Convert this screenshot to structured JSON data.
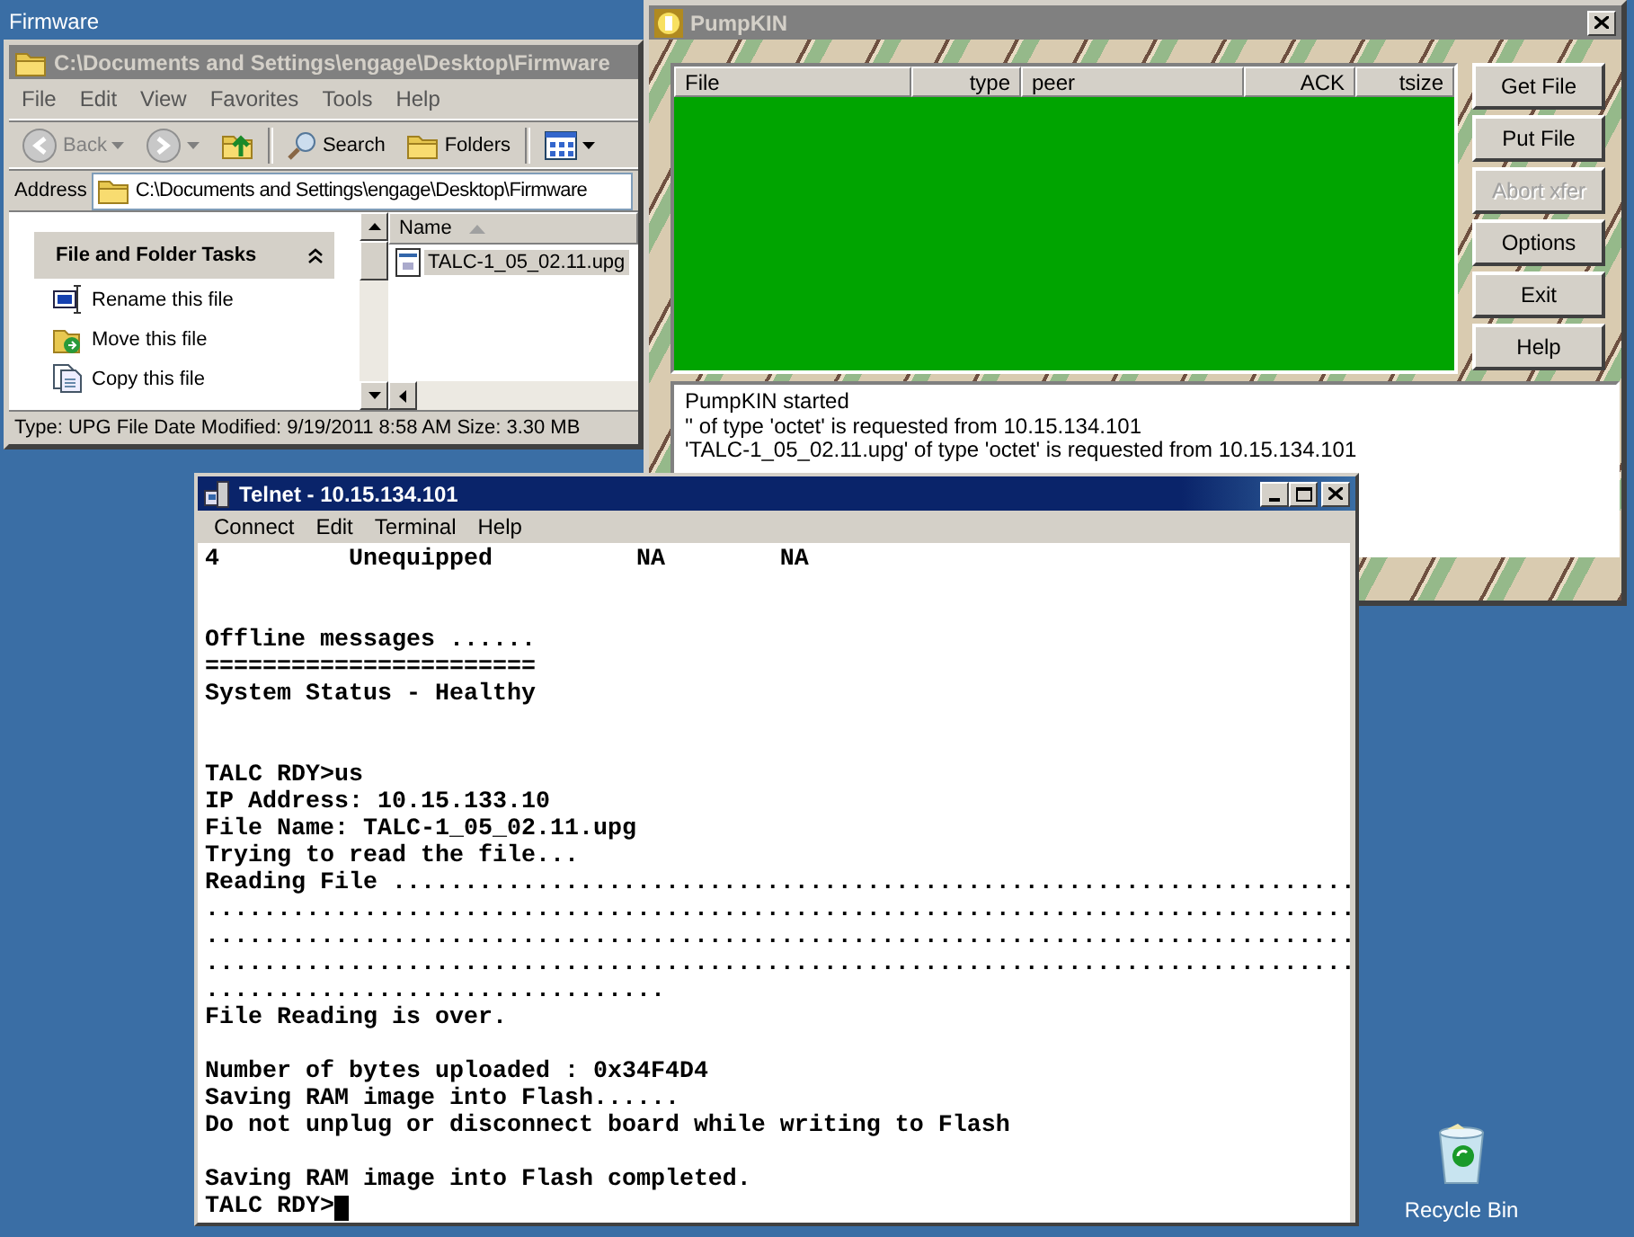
{
  "desktop": {
    "icons": [
      {
        "label": "Firmware",
        "kind": "folder"
      },
      {
        "label": "Recycle Bin",
        "kind": "recycle"
      }
    ]
  },
  "explorer": {
    "title": "C:\\Documents and Settings\\engage\\Desktop\\Firmware",
    "active": false,
    "menu": [
      "File",
      "Edit",
      "View",
      "Favorites",
      "Tools",
      "Help"
    ],
    "toolbar": {
      "back": "Back",
      "search": "Search",
      "folders": "Folders"
    },
    "address_label": "Address",
    "address": "C:\\Documents and Settings\\engage\\Desktop\\Firmware",
    "tasks_title": "File and Folder Tasks",
    "tasks": [
      "Rename this file",
      "Move this file",
      "Copy this file"
    ],
    "column": "Name",
    "files": [
      {
        "name": "TALC-1_05_02.11.upg",
        "selected": true
      }
    ],
    "status": "Type: UPG File Date Modified: 9/19/2011 8:58 AM Size: 3.30 MB"
  },
  "pumpkin": {
    "title": "PumpKIN",
    "active": false,
    "columns": [
      "File",
      "type",
      "peer",
      "ACK",
      "tsize"
    ],
    "buttons": [
      {
        "label": "Get File",
        "disabled": false
      },
      {
        "label": "Put File",
        "disabled": false
      },
      {
        "label": "Abort xfer",
        "disabled": true
      },
      {
        "label": "Options",
        "disabled": false
      },
      {
        "label": "Exit",
        "disabled": false
      },
      {
        "label": "Help",
        "disabled": false
      }
    ],
    "log": [
      "PumpKIN started",
      "'' of type 'octet' is requested from 10.15.134.101",
      "'TALC-1_05_02.11.upg' of type 'octet' is requested from 10.15.134.101"
    ]
  },
  "telnet": {
    "title": "Telnet - 10.15.134.101",
    "active": true,
    "menu": [
      "Connect",
      "Edit",
      "Terminal",
      "Help"
    ],
    "lines": [
      {
        "kind": "text",
        "text": "4         Unequipped          NA        NA"
      },
      {
        "kind": "blank"
      },
      {
        "kind": "blank"
      },
      {
        "kind": "text",
        "text": "Offline messages ......"
      },
      {
        "kind": "text",
        "text": "======================="
      },
      {
        "kind": "text",
        "text": "System Status - Healthy"
      },
      {
        "kind": "blank"
      },
      {
        "kind": "blank"
      },
      {
        "kind": "text",
        "text": "TALC RDY>us"
      },
      {
        "kind": "text",
        "text": "IP Address: 10.15.133.10"
      },
      {
        "kind": "text",
        "text": "File Name: TALC-1_05_02.11.upg"
      },
      {
        "kind": "text",
        "text": "Trying to read the file..."
      },
      {
        "kind": "text",
        "text": "Reading File ..................................................................."
      },
      {
        "kind": "text",
        "text": "................................................................................"
      },
      {
        "kind": "text",
        "text": "................................................................................"
      },
      {
        "kind": "text",
        "text": "................................................................................"
      },
      {
        "kind": "text",
        "text": "................................"
      },
      {
        "kind": "text",
        "text": "File Reading is over."
      },
      {
        "kind": "blank"
      },
      {
        "kind": "text",
        "text": "Number of bytes uploaded : 0x34F4D4"
      },
      {
        "kind": "text",
        "text": "Saving RAM image into Flash......"
      },
      {
        "kind": "text",
        "text": "Do not unplug or disconnect board while writing to Flash"
      },
      {
        "kind": "blank"
      },
      {
        "kind": "text",
        "text": "Saving RAM image into Flash completed."
      },
      {
        "kind": "text",
        "text": "TALC RDY>"
      }
    ],
    "cursor": true
  }
}
